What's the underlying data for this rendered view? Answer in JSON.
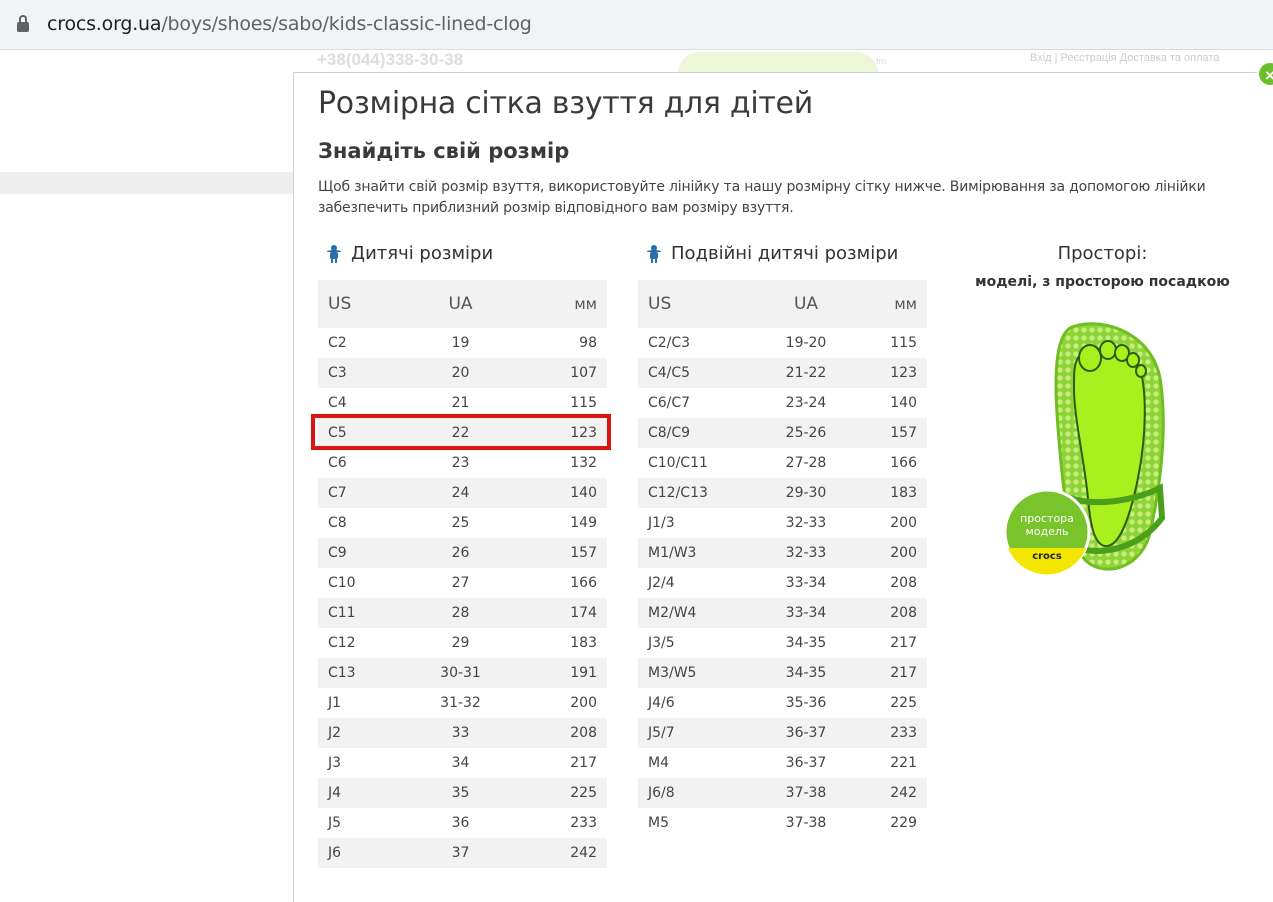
{
  "browser": {
    "url_domain": "crocs.org.ua",
    "url_path": "/boys/shoes/sabo/kids-classic-lined-clog"
  },
  "background": {
    "phone": "+38(044)338-30-38",
    "links": "Вхід  |  Реєстрація       Доставка та оплата",
    "tm": "tm"
  },
  "modal": {
    "close_label": "×",
    "title": "Розмірна сітка взуття для дітей",
    "subtitle": "Знайдіть свій розмір",
    "description": "Щоб знайти свій розмір взуття, використовуйте лінійку та нашу розмірну сітку нижче. Вимірювання за допомогою лінійки забезпечить приблизний розмір відповідного вам розміру взуття."
  },
  "kids_table": {
    "heading": "Дитячі розміри",
    "columns": [
      "US",
      "UA",
      "мм"
    ],
    "rows": [
      [
        "C2",
        "19",
        "98"
      ],
      [
        "C3",
        "20",
        "107"
      ],
      [
        "C4",
        "21",
        "115"
      ],
      [
        "C5",
        "22",
        "123"
      ],
      [
        "C6",
        "23",
        "132"
      ],
      [
        "C7",
        "24",
        "140"
      ],
      [
        "C8",
        "25",
        "149"
      ],
      [
        "C9",
        "26",
        "157"
      ],
      [
        "C10",
        "27",
        "166"
      ],
      [
        "C11",
        "28",
        "174"
      ],
      [
        "C12",
        "29",
        "183"
      ],
      [
        "C13",
        "30-31",
        "191"
      ],
      [
        "J1",
        "31-32",
        "200"
      ],
      [
        "J2",
        "33",
        "208"
      ],
      [
        "J3",
        "34",
        "217"
      ],
      [
        "J4",
        "35",
        "225"
      ],
      [
        "J5",
        "36",
        "233"
      ],
      [
        "J6",
        "37",
        "242"
      ]
    ]
  },
  "dual_table": {
    "heading": "Подвійні дитячі розміри",
    "columns": [
      "US",
      "UA",
      "мм"
    ],
    "rows": [
      [
        "C2/C3",
        "19-20",
        "115"
      ],
      [
        "C4/C5",
        "21-22",
        "123"
      ],
      [
        "C6/C7",
        "23-24",
        "140"
      ],
      [
        "C8/C9",
        "25-26",
        "157"
      ],
      [
        "C10/C11",
        "27-28",
        "166"
      ],
      [
        "C12/C13",
        "29-30",
        "183"
      ],
      [
        "J1/3",
        "32-33",
        "200"
      ],
      [
        "M1/W3",
        "32-33",
        "200"
      ],
      [
        "J2/4",
        "33-34",
        "208"
      ],
      [
        "M2/W4",
        "33-34",
        "208"
      ],
      [
        "J3/5",
        "34-35",
        "217"
      ],
      [
        "M3/W5",
        "34-35",
        "217"
      ],
      [
        "J4/6",
        "35-36",
        "225"
      ],
      [
        "J5/7",
        "36-37",
        "233"
      ],
      [
        "M4",
        "36-37",
        "221"
      ],
      [
        "J6/8",
        "37-38",
        "242"
      ],
      [
        "M5",
        "37-38",
        "229"
      ]
    ]
  },
  "roomy": {
    "title": "Просторі:",
    "subtitle": "моделі, з просторою посадкою",
    "badge_line1": "простора",
    "badge_line2": "модель",
    "badge_brand": "crocs"
  },
  "colors": {
    "highlight": "#d9150f",
    "accent_green": "#6bbf2b",
    "icon_blue": "#2a6fa8"
  }
}
